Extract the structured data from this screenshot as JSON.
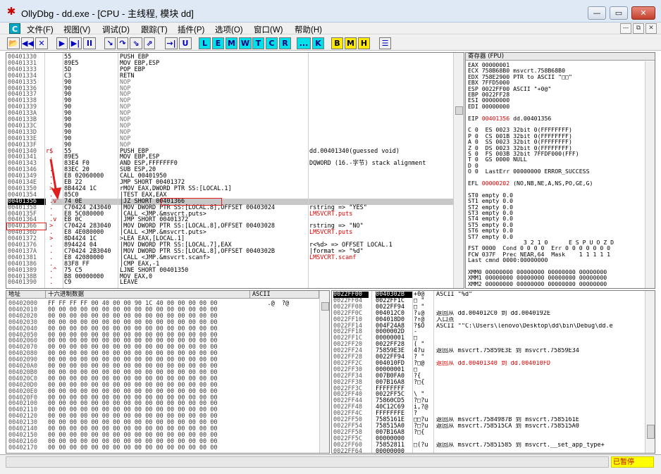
{
  "window": {
    "title": "OllyDbg - dd.exe - [CPU - 主线程, 模块 dd]",
    "controls": {
      "minimize": "—",
      "restore": "▭",
      "close": "✕"
    }
  },
  "menu": {
    "c_button": "C",
    "items": [
      "文件(F)",
      "视图(V)",
      "调试(D)",
      "跟踪(T)",
      "插件(P)",
      "选项(O)",
      "窗口(W)",
      "帮助(H)"
    ],
    "mdi": {
      "minimize": "—",
      "restore": "⧉",
      "close": "✕"
    }
  },
  "toolbar": {
    "buttons": [
      {
        "name": "open",
        "label": "📂"
      },
      {
        "name": "restart",
        "label": "◀◀"
      },
      {
        "name": "close-proc",
        "label": "✕"
      },
      {
        "name": "run",
        "label": "▶"
      },
      {
        "name": "run-thread",
        "label": "▶|"
      },
      {
        "name": "pause",
        "label": "II"
      },
      {
        "name": "step-into",
        "label": "↘"
      },
      {
        "name": "step-over",
        "label": "↷"
      },
      {
        "name": "trace-into",
        "label": "⇘"
      },
      {
        "name": "trace-over",
        "label": "⇗"
      },
      {
        "name": "till-return",
        "label": "→|"
      },
      {
        "name": "up",
        "label": "U"
      },
      {
        "name": "L",
        "label": "L"
      },
      {
        "name": "E",
        "label": "E"
      },
      {
        "name": "M",
        "label": "M"
      },
      {
        "name": "W",
        "label": "W"
      },
      {
        "name": "T",
        "label": "T"
      },
      {
        "name": "C",
        "label": "C"
      },
      {
        "name": "R",
        "label": "R"
      },
      {
        "name": "dots",
        "label": "..."
      },
      {
        "name": "K",
        "label": "K"
      },
      {
        "name": "B",
        "label": "B"
      },
      {
        "name": "M2",
        "label": "M"
      },
      {
        "name": "H",
        "label": "H"
      },
      {
        "name": "list",
        "label": "☰"
      }
    ]
  },
  "disasm": {
    "rows": [
      {
        "addr": "00401330",
        "mark": " ",
        "hex": "55",
        "asm": "PUSH EBP",
        "comment": ""
      },
      {
        "addr": "00401331",
        "mark": " ",
        "hex": "89E5",
        "asm": "MOV EBP,ESP",
        "comment": ""
      },
      {
        "addr": "00401333",
        "mark": " ",
        "hex": "5D",
        "asm": "POP EBP",
        "comment": ""
      },
      {
        "addr": "00401334",
        "mark": " ",
        "hex": "C3",
        "asm": "RETN",
        "comment": ""
      },
      {
        "addr": "00401335",
        "mark": " ",
        "hex": "90",
        "asm": "NOP",
        "comment": ""
      },
      {
        "addr": "00401336",
        "mark": " ",
        "hex": "90",
        "asm": "NOP",
        "comment": ""
      },
      {
        "addr": "00401337",
        "mark": " ",
        "hex": "90",
        "asm": "NOP",
        "comment": ""
      },
      {
        "addr": "00401338",
        "mark": " ",
        "hex": "90",
        "asm": "NOP",
        "comment": ""
      },
      {
        "addr": "00401339",
        "mark": " ",
        "hex": "90",
        "asm": "NOP",
        "comment": ""
      },
      {
        "addr": "0040133A",
        "mark": " ",
        "hex": "90",
        "asm": "NOP",
        "comment": ""
      },
      {
        "addr": "0040133B",
        "mark": " ",
        "hex": "90",
        "asm": "NOP",
        "comment": ""
      },
      {
        "addr": "0040133C",
        "mark": " ",
        "hex": "90",
        "asm": "NOP",
        "comment": ""
      },
      {
        "addr": "0040133D",
        "mark": " ",
        "hex": "90",
        "asm": "NOP",
        "comment": ""
      },
      {
        "addr": "0040133E",
        "mark": " ",
        "hex": "90",
        "asm": "NOP",
        "comment": ""
      },
      {
        "addr": "0040133F",
        "mark": " ",
        "hex": "90",
        "asm": "NOP",
        "comment": ""
      },
      {
        "addr": "00401340",
        "mark": "r$",
        "hex": "55",
        "asm": "PUSH EBP",
        "comment": "dd.00401340(guessed void)"
      },
      {
        "addr": "00401341",
        "mark": " .",
        "hex": "89E5",
        "asm": "MOV EBP,ESP",
        "comment": ""
      },
      {
        "addr": "00401343",
        "mark": " .",
        "hex": "83E4 F0",
        "asm": "AND ESP,FFFFFFF0",
        "comment": "DQWORD (16.-字节) stack alignment"
      },
      {
        "addr": "00401346",
        "mark": " .",
        "hex": "83EC 20",
        "asm": "SUB ESP,20",
        "comment": ""
      },
      {
        "addr": "00401349",
        "mark": " .",
        "hex": "E8 02060000",
        "asm": "CALL 00401950",
        "comment": ""
      },
      {
        "addr": "0040134E",
        "mark": " .",
        "hex": "EB 22",
        "asm": "JMP SHORT 00401372",
        "comment": ""
      },
      {
        "addr": "00401350",
        "mark": " >",
        "hex": "8B4424 1C",
        "asm": "rMOV EAX,DWORD PTR SS:[LOCAL.1]",
        "comment": ""
      },
      {
        "addr": "00401354",
        "mark": " .",
        "hex": "85C0",
        "asm": "|TEST EAX,EAX",
        "comment": ""
      },
      {
        "addr": "00401356",
        "mark": " .v",
        "hex": "74 0E",
        "asm": "|JZ SHORT 00401366",
        "comment": ""
      },
      {
        "addr": "00401358",
        "mark": " .",
        "hex": "C70424 243040",
        "asm": "|MOV DWORD PTR SS:[LOCAL.8],OFFSET 00403024",
        "comment": "rstring => \"YES\""
      },
      {
        "addr": "0040135F",
        "mark": " .",
        "hex": "E8 5C080000",
        "asm": "|CALL <JMP.&msvcrt.puts>",
        "comment": "LMSVCRT.puts"
      },
      {
        "addr": "00401364",
        "mark": " .v",
        "hex": "EB 0C",
        "asm": "|JMP SHORT 00401372",
        "comment": ""
      },
      {
        "addr": "00401366",
        "mark": " >",
        "hex": "C70424 283040",
        "asm": "|MOV DWORD PTR SS:[LOCAL.8],OFFSET 00403028",
        "comment": "rstring => \"NO\""
      },
      {
        "addr": "0040136D",
        "mark": " .",
        "hex": "E8 4E080000",
        "asm": "|CALL <JMP.&msvcrt.puts>",
        "comment": "LMSVCRT.puts"
      },
      {
        "addr": "00401372",
        "mark": " >",
        "hex": "8D4424 1C",
        "asm": ">LEA EAX,[LOCAL.1]",
        "comment": ""
      },
      {
        "addr": "00401376",
        "mark": " .",
        "hex": "894424 04",
        "asm": "|MOV DWORD PTR SS:[LOCAL.7],EAX",
        "comment": "r<%d> => OFFSET LOCAL.1"
      },
      {
        "addr": "0040137A",
        "mark": " .",
        "hex": "C70424 2B3040",
        "asm": "|MOV DWORD PTR SS:[LOCAL.8],OFFSET 0040302B",
        "comment": "|format => \"%d\""
      },
      {
        "addr": "00401381",
        "mark": " .",
        "hex": "E8 42080000",
        "asm": "|CALL <JMP.&msvcrt.scanf>",
        "comment": "LMSVCRT.scanf"
      },
      {
        "addr": "00401386",
        "mark": " .",
        "hex": "83F8 FF",
        "asm": "|CMP EAX,-1",
        "comment": ""
      },
      {
        "addr": "00401389",
        "mark": " .^",
        "hex": "75 C5",
        "asm": "LJNE SHORT 00401350",
        "comment": ""
      },
      {
        "addr": "0040138B",
        "mark": " .",
        "hex": "B8 00000000",
        "asm": "MOV EAX,0",
        "comment": ""
      },
      {
        "addr": "00401390",
        "mark": " .",
        "hex": "C9",
        "asm": "LEAVE",
        "comment": ""
      }
    ],
    "selected_row": 23
  },
  "registers": {
    "header": "寄存器 (FPU)",
    "lines": [
      {
        "t": "EAX 00000001",
        "c": "n"
      },
      {
        "t": "ECX 758B68B0 msvcrt.758B68B0",
        "c": "n"
      },
      {
        "t": "EDX 758E2900 PTR to ASCII \"□□\"",
        "c": "n"
      },
      {
        "t": "EBX 7FFD5000",
        "c": "n"
      },
      {
        "t": "ESP 0022FF00 ASCII \"+0@\"",
        "c": "n"
      },
      {
        "t": "EBP 0022FF28",
        "c": "n"
      },
      {
        "t": "ESI 00000000",
        "c": "n"
      },
      {
        "t": "EDI 00000000",
        "c": "n"
      },
      {
        "t": "",
        "c": "n"
      },
      {
        "t": "EIP 00401356 dd.00401356",
        "c": "eip"
      },
      {
        "t": "",
        "c": "n"
      },
      {
        "t": "C 0  ES 0023 32bit 0(FFFFFFFF)",
        "c": "n"
      },
      {
        "t": "P 0  CS 001B 32bit 0(FFFFFFFF)",
        "c": "n"
      },
      {
        "t": "A 0  SS 0023 32bit 0(FFFFFFFF)",
        "c": "n"
      },
      {
        "t": "Z 0  DS 0023 32bit 0(FFFFFFFF)",
        "c": "n"
      },
      {
        "t": "S 0  FS 003B 32bit 7FFDF000(FFF)",
        "c": "n"
      },
      {
        "t": "T 0  GS 0000 NULL",
        "c": "n"
      },
      {
        "t": "D 0",
        "c": "n"
      },
      {
        "t": "O 0  LastErr 00000000 ERROR_SUCCESS",
        "c": "n"
      },
      {
        "t": "",
        "c": "n"
      },
      {
        "t": "EFL 00000202 (NO,NB,NE,A,NS,PO,GE,G)",
        "c": "efl"
      },
      {
        "t": "",
        "c": "n"
      },
      {
        "t": "ST0 empty 0.0",
        "c": "n"
      },
      {
        "t": "ST1 empty 0.0",
        "c": "n"
      },
      {
        "t": "ST2 empty 0.0",
        "c": "n"
      },
      {
        "t": "ST3 empty 0.0",
        "c": "n"
      },
      {
        "t": "ST4 empty 0.0",
        "c": "n"
      },
      {
        "t": "ST5 empty 0.0",
        "c": "n"
      },
      {
        "t": "ST6 empty 0.0",
        "c": "n"
      },
      {
        "t": "ST7 empty 0.0",
        "c": "n"
      },
      {
        "t": "                3 2 1 0      E S P U O Z D",
        "c": "n"
      },
      {
        "t": "FST 0000  Cond 0 0 0 0  Err 0 0 0 0 0 0 0",
        "c": "n"
      },
      {
        "t": "FCW 037F  Prec NEAR,64  Mask    1 1 1 1 1",
        "c": "n"
      },
      {
        "t": "Last cmnd 0000:00000000",
        "c": "n"
      },
      {
        "t": "",
        "c": "n"
      },
      {
        "t": "XMM0 00000000 00000000 00000000 00000000",
        "c": "n"
      },
      {
        "t": "XMM1 00000000 00000000 00000000 00000000",
        "c": "n"
      },
      {
        "t": "XMM2 00000000 00000000 00000000 00000000",
        "c": "n"
      }
    ],
    "eip_value": "00401356",
    "efl_value": "00000202"
  },
  "dump": {
    "headers": {
      "addr": "地址",
      "hex": "十六进制数据",
      "ascii": "ASCII"
    },
    "rows": [
      {
        "a": "00402000",
        "h": "FF FF FF FF 00 40 00 00 90 1C 40 00 00 00 00 00",
        "s": "    .@  ?@"
      },
      {
        "a": "00402010",
        "h": "00 00 00 00 00 00 00 00 00 00 00 00 00 00 00 00",
        "s": ""
      },
      {
        "a": "00402020",
        "h": "00 00 00 00 00 00 00 00 00 00 00 00 00 00 00 00",
        "s": ""
      },
      {
        "a": "00402030",
        "h": "00 00 00 00 00 00 00 00 00 00 00 00 00 00 00 00",
        "s": ""
      },
      {
        "a": "00402040",
        "h": "00 00 00 00 00 00 00 00 00 00 00 00 00 00 00 00",
        "s": ""
      },
      {
        "a": "00402050",
        "h": "00 00 00 00 00 00 00 00 00 00 00 00 00 00 00 00",
        "s": ""
      },
      {
        "a": "00402060",
        "h": "00 00 00 00 00 00 00 00 00 00 00 00 00 00 00 00",
        "s": ""
      },
      {
        "a": "00402070",
        "h": "00 00 00 00 00 00 00 00 00 00 00 00 00 00 00 00",
        "s": ""
      },
      {
        "a": "00402080",
        "h": "00 00 00 00 00 00 00 00 00 00 00 00 00 00 00 00",
        "s": ""
      },
      {
        "a": "00402090",
        "h": "00 00 00 00 00 00 00 00 00 00 00 00 00 00 00 00",
        "s": ""
      },
      {
        "a": "004020A0",
        "h": "00 00 00 00 00 00 00 00 00 00 00 00 00 00 00 00",
        "s": ""
      },
      {
        "a": "004020B0",
        "h": "00 00 00 00 00 00 00 00 00 00 00 00 00 00 00 00",
        "s": ""
      },
      {
        "a": "004020C0",
        "h": "00 00 00 00 00 00 00 00 00 00 00 00 00 00 00 00",
        "s": ""
      },
      {
        "a": "004020D0",
        "h": "00 00 00 00 00 00 00 00 00 00 00 00 00 00 00 00",
        "s": ""
      },
      {
        "a": "004020E0",
        "h": "00 00 00 00 00 00 00 00 00 00 00 00 00 00 00 00",
        "s": ""
      },
      {
        "a": "004020F0",
        "h": "00 00 00 00 00 00 00 00 00 00 00 00 00 00 00 00",
        "s": ""
      },
      {
        "a": "00402100",
        "h": "00 00 00 00 00 00 00 00 00 00 00 00 00 00 00 00",
        "s": ""
      },
      {
        "a": "00402110",
        "h": "00 00 00 00 00 00 00 00 00 00 00 00 00 00 00 00",
        "s": ""
      },
      {
        "a": "00402120",
        "h": "00 00 00 00 00 00 00 00 00 00 00 00 00 00 00 00",
        "s": ""
      },
      {
        "a": "00402130",
        "h": "00 00 00 00 00 00 00 00 00 00 00 00 00 00 00 00",
        "s": ""
      },
      {
        "a": "00402140",
        "h": "00 00 00 00 00 00 00 00 00 00 00 00 00 00 00 00",
        "s": ""
      },
      {
        "a": "00402150",
        "h": "00 00 00 00 00 00 00 00 00 00 00 00 00 00 00 00",
        "s": ""
      },
      {
        "a": "00402160",
        "h": "00 00 00 00 00 00 00 00 00 00 00 00 00 00 00 00",
        "s": ""
      },
      {
        "a": "00402170",
        "h": "00 00 00 00 00 00 00 00 00 00 00 00 00 00 00 00",
        "s": ""
      }
    ]
  },
  "stack": {
    "rows": [
      {
        "a": "0022FF00",
        "v": "0040302B",
        "s": "+0@",
        "c": "ASCII \"%d\"",
        "red": false,
        "hl": true
      },
      {
        "a": "0022FF04",
        "v": "0022FF1C",
        "s": "□ \"",
        "c": "",
        "red": false
      },
      {
        "a": "0022FF08",
        "v": "0022FF94",
        "s": "□ \"",
        "c": "",
        "red": false
      },
      {
        "a": "0022FF0C",
        "v": "004012C0",
        "s": "?↓@",
        "c": "返回从 dd.004012C0 到 dd.0040192E",
        "red": false
      },
      {
        "a": "0022FF10",
        "v": "004018D0",
        "s": "?↑@",
        "c": "入口点",
        "red": false
      },
      {
        "a": "0022FF14",
        "v": "004F24A8",
        "s": "?$O",
        "c": "ASCII \"\"C:\\Users\\lenovo\\Desktop\\dd\\bin\\Debug\\dd.e",
        "red": false
      },
      {
        "a": "0022FF18",
        "v": "0000002D",
        "s": "-",
        "c": "",
        "red": false
      },
      {
        "a": "0022FF1C",
        "v": "00000001",
        "s": "□",
        "c": "",
        "red": false
      },
      {
        "a": "0022FF20",
        "v": "0022FF28",
        "s": "( \"",
        "c": "",
        "red": false
      },
      {
        "a": "0022FF24",
        "v": "75859E3E",
        "s": "4?u",
        "c": "返回从 msvcrt.75859E3E 到 msvcrt.75859E34",
        "red": false
      },
      {
        "a": "0022FF28",
        "v": "0022FF94",
        "s": "? \"",
        "c": "",
        "red": false
      },
      {
        "a": "0022FF2C",
        "v": "004010FD",
        "s": "?□@",
        "c": "返回从 dd.00401340 到 dd.004010FD",
        "red": true
      },
      {
        "a": "0022FF30",
        "v": "00000001",
        "s": "□",
        "c": "",
        "red": false
      },
      {
        "a": "0022FF34",
        "v": "007B0FA0",
        "s": "?{",
        "c": "",
        "red": false
      },
      {
        "a": "0022FF38",
        "v": "007B16A8",
        "s": "?□{",
        "c": "",
        "red": false
      },
      {
        "a": "0022FF3C",
        "v": "FFFFFFFF",
        "s": "",
        "c": "",
        "red": false
      },
      {
        "a": "0022FF40",
        "v": "0022FF5C",
        "s": "\\ \"",
        "c": "",
        "red": false
      },
      {
        "a": "0022FF44",
        "v": "75860CD5",
        "s": "?□?u",
        "c": "",
        "red": false
      },
      {
        "a": "0022FF48",
        "v": "40C12C69",
        "s": "i,?@",
        "c": "",
        "red": false
      },
      {
        "a": "0022FF4C",
        "v": "FFFFFFFE",
        "s": "?",
        "c": "",
        "red": false
      },
      {
        "a": "0022FF50",
        "v": "7585161E",
        "s": "□□?u",
        "c": "返回从 msvcrt.7584987B 到 msvcrt.7585161E",
        "red": false
      },
      {
        "a": "0022FF54",
        "v": "758515A0",
        "s": "?□?u",
        "c": "返回从 msvcrt.758515CA 到 msvcrt.758515A0",
        "red": false
      },
      {
        "a": "0022FF58",
        "v": "007B16A8",
        "s": "?□{",
        "c": "",
        "red": false
      },
      {
        "a": "0022FF5C",
        "v": "00000000",
        "s": "",
        "c": "",
        "red": false
      },
      {
        "a": "0022FF60",
        "v": "75852811",
        "s": "□(?u",
        "c": "返回从 msvcrt.75851585 到 msvcrt.__set_app_type+",
        "red": false
      },
      {
        "a": "0022FF64",
        "v": "00000000",
        "s": "",
        "c": "",
        "red": false
      }
    ]
  },
  "status": {
    "message": "",
    "state": "已暂停"
  },
  "colors": {
    "accent_red": "#e00000",
    "paused_bg": "#ffff00",
    "toolbar_cyan": "#00e0e8",
    "toolbar_yellow": "#ffe800"
  }
}
